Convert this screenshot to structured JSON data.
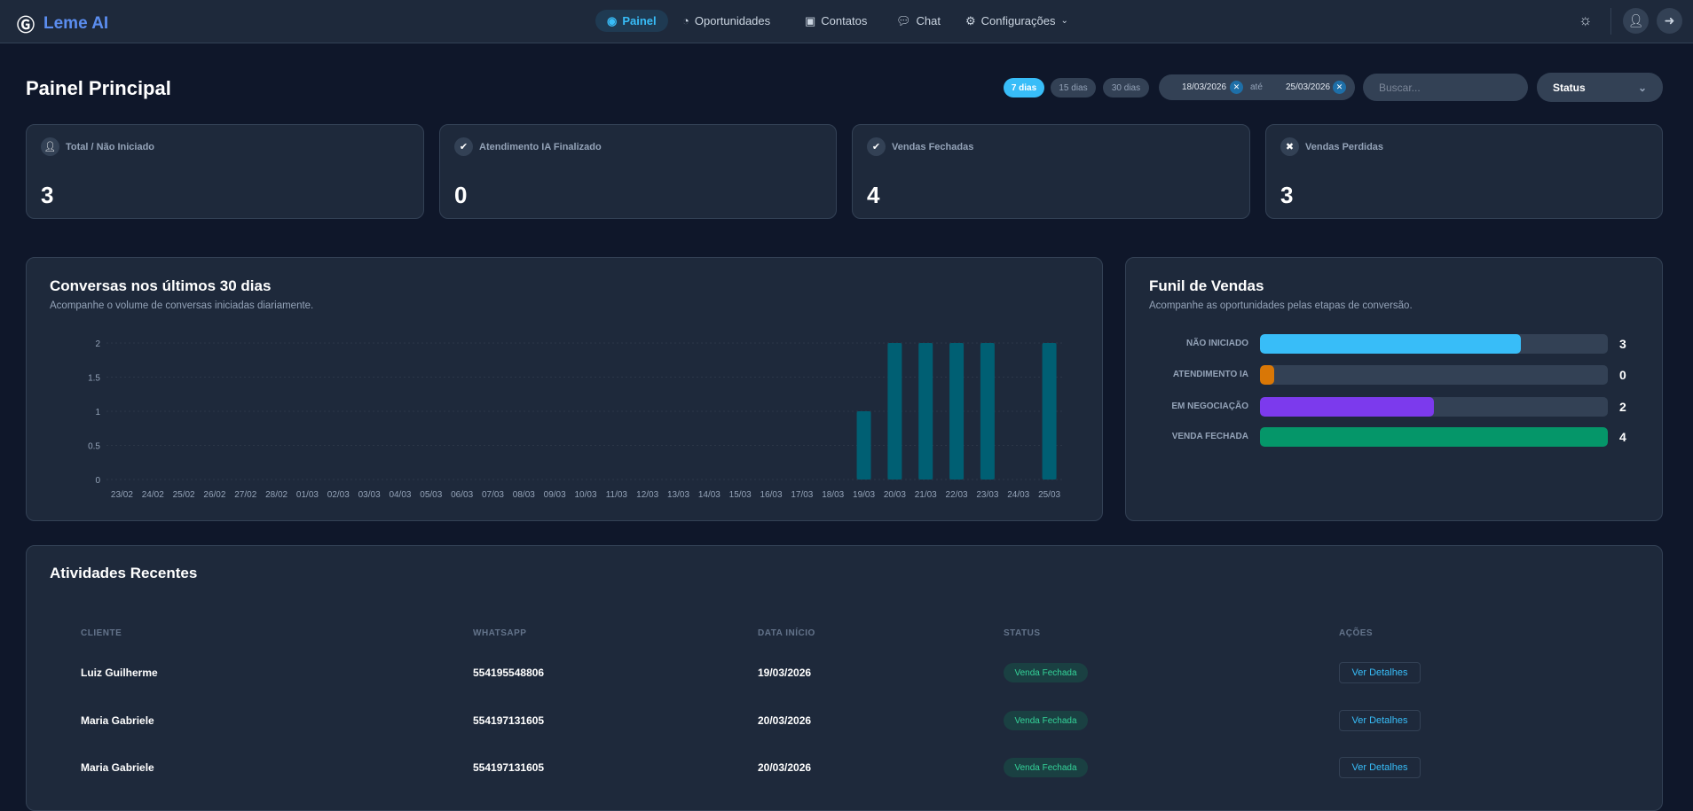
{
  "brand": {
    "name": "Leme AI",
    "color": "#5b8def"
  },
  "nav": {
    "items": [
      {
        "label": "Painel",
        "icon": "gauge-icon",
        "active": true
      },
      {
        "label": "Oportunidades",
        "icon": "pie-chart-icon"
      },
      {
        "label": "Contatos",
        "icon": "address-book-icon"
      },
      {
        "label": "Chat",
        "icon": "comments-icon"
      },
      {
        "label": "Configurações",
        "icon": "gear-icon"
      }
    ]
  },
  "page": {
    "title": "Painel Principal"
  },
  "filters": {
    "ranges": [
      "7 dias",
      "15 dias",
      "30 dias"
    ],
    "active_range": "7 dias",
    "date_from": "18/03/2026",
    "date_sep": "até",
    "date_to": "25/03/2026",
    "search_placeholder": "Buscar...",
    "status_label": "Status"
  },
  "cards": [
    {
      "label": "Total / Não Iniciado",
      "value": "3",
      "icon": "user-plus-icon"
    },
    {
      "label": "Atendimento IA Finalizado",
      "value": "0",
      "icon": "check-circle-icon"
    },
    {
      "label": "Vendas Fechadas",
      "value": "4",
      "icon": "check-circle-icon"
    },
    {
      "label": "Vendas Perdidas",
      "value": "3",
      "icon": "x-circle-icon"
    }
  ],
  "chart_panel": {
    "title": "Conversas nos últimos 30 dias",
    "subtitle": "Acompanhe o volume de conversas iniciadas diariamente."
  },
  "chart_data": {
    "type": "bar",
    "categories": [
      "23/02",
      "24/02",
      "25/02",
      "26/02",
      "27/02",
      "28/02",
      "01/03",
      "02/03",
      "03/03",
      "04/03",
      "05/03",
      "06/03",
      "07/03",
      "08/03",
      "09/03",
      "10/03",
      "11/03",
      "12/03",
      "13/03",
      "14/03",
      "15/03",
      "16/03",
      "17/03",
      "18/03",
      "19/03",
      "20/03",
      "21/03",
      "22/03",
      "23/03",
      "24/03",
      "25/03"
    ],
    "values": [
      0,
      0,
      0,
      0,
      0,
      0,
      0,
      0,
      0,
      0,
      0,
      0,
      0,
      0,
      0,
      0,
      0,
      0,
      0,
      0,
      0,
      0,
      0,
      0,
      1,
      2,
      2,
      2,
      2,
      0,
      2
    ],
    "yticks": [
      "0",
      "0.5",
      "1",
      "1.5",
      "2"
    ],
    "ylim": [
      0,
      2
    ],
    "grid": true,
    "color": "#005f73"
  },
  "funnel": {
    "title": "Funil de Vendas",
    "subtitle": "Acompanhe as oportunidades pelas etapas de conversão.",
    "max": 4,
    "stages": [
      {
        "label": "NÃO INICIADO",
        "value": "3",
        "color": "#38bdf8"
      },
      {
        "label": "ATENDIMENTO IA",
        "value": "0",
        "color": "#d97706"
      },
      {
        "label": "EM NEGOCIAÇÃO",
        "value": "2",
        "color": "#7c3aed"
      },
      {
        "label": "VENDA FECHADA",
        "value": "4",
        "color": "#059669"
      }
    ]
  },
  "recent": {
    "title": "Atividades Recentes",
    "headers": [
      "CLIENTE",
      "WHATSAPP",
      "DATA INÍCIO",
      "STATUS",
      "AÇÕES"
    ],
    "rows": [
      {
        "cliente": "Luiz Guilherme",
        "whatsapp": "554195548806",
        "data": "19/03/2026",
        "status": "Venda Fechada",
        "action": "Ver Detalhes"
      },
      {
        "cliente": "Maria Gabriele",
        "whatsapp": "554197131605",
        "data": "20/03/2026",
        "status": "Venda Fechada",
        "action": "Ver Detalhes"
      },
      {
        "cliente": "Maria Gabriele",
        "whatsapp": "554197131605",
        "data": "20/03/2026",
        "status": "Venda Fechada",
        "action": "Ver Detalhes"
      }
    ]
  }
}
